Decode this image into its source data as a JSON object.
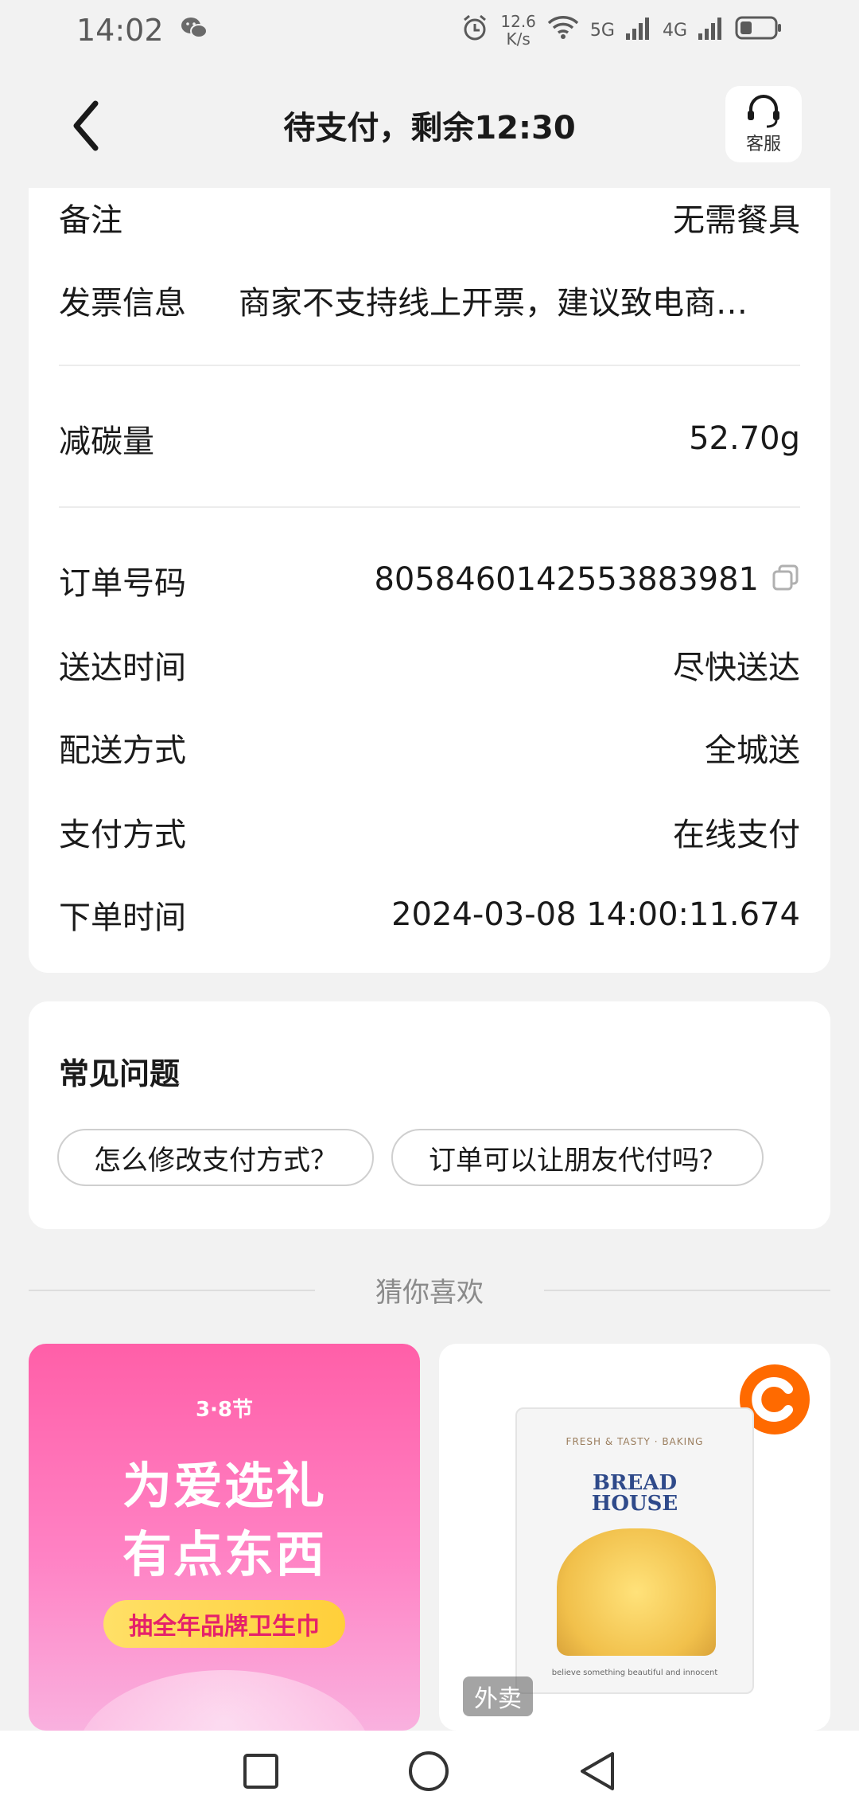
{
  "status_bar": {
    "time": "14:02",
    "net_speed_value": "12.6",
    "net_speed_unit": "K/s",
    "signal_5g": "5G",
    "signal_4g": "4G"
  },
  "header": {
    "title": "待支付，剩余12:30",
    "customer_service_label": "客服"
  },
  "order_info": {
    "remark_label": "备注",
    "remark_value": "无需餐具",
    "invoice_label": "发票信息",
    "invoice_value": "商家不支持线上开票，建议致电商…",
    "carbon_label": "减碳量",
    "carbon_value": "52.70g",
    "order_no_label": "订单号码",
    "order_no_value": "8058460142553883981",
    "delivery_time_label": "送达时间",
    "delivery_time_value": "尽快送达",
    "delivery_method_label": "配送方式",
    "delivery_method_value": "全城送",
    "payment_method_label": "支付方式",
    "payment_method_value": "在线支付",
    "order_time_label": "下单时间",
    "order_time_value": "2024-03-08 14:00:11.674"
  },
  "faq": {
    "title": "常见问题",
    "questions": [
      "怎么修改支付方式？",
      "订单可以让朋友代付吗？"
    ]
  },
  "recommend": {
    "title": "猜你喜欢",
    "promo": {
      "tag": "3·8节",
      "line1": "为爱选礼",
      "line2": "有点东西",
      "badge": "抽全年品牌卫生巾"
    },
    "product": {
      "package_top": "FRESH & TASTY · BAKING",
      "package_brand_1": "BREAD",
      "package_brand_2": "HOUSE",
      "package_bottom": "believe something beautiful and innocent",
      "tag": "外卖"
    }
  },
  "colors": {
    "accent_orange": "#ff6a00",
    "promo_pink": "#ff5fa8",
    "promo_badge": "#ffd84a"
  },
  "icons": {
    "back": "chevron-left-icon",
    "customer_service": "headset-icon",
    "copy": "copy-icon",
    "nav": [
      "square-recents-icon",
      "circle-home-icon",
      "triangle-back-icon"
    ]
  }
}
